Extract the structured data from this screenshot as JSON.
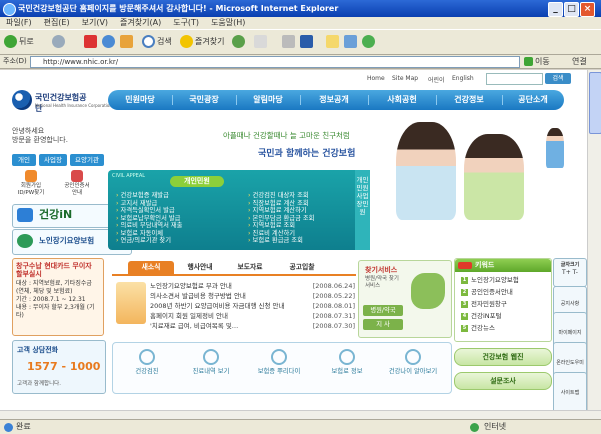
{
  "window": {
    "title": "국민건강보험공단 홈페이지를 방문해주셔서 감사합니다! - Microsoft Internet Explorer",
    "buttons": [
      "_",
      "□",
      "×"
    ]
  },
  "menubar": [
    "파일(F)",
    "편집(E)",
    "보기(V)",
    "즐겨찾기(A)",
    "도구(T)",
    "도움말(H)"
  ],
  "toolbar": {
    "back": "뒤로",
    "search": "검색",
    "favorites": "즐겨찾기"
  },
  "address": {
    "label": "주소(D)",
    "url": "http://www.nhic.or.kr/",
    "go": "이동",
    "links": "연결"
  },
  "top_links": [
    "Home",
    "Site Map",
    "어린이",
    "English"
  ],
  "search_button": "검색",
  "logo": {
    "name": "국민건강보험공단",
    "sub": "National Health Insurance Corporation"
  },
  "gnb": [
    "민원마당",
    "국민광장",
    "알림마당",
    "정보공개",
    "사회공헌",
    "건강정보",
    "공단소개"
  ],
  "greeting": [
    "안녕하세요",
    "방문을 환영합니다."
  ],
  "quick_buttons": [
    "개인",
    "사업장",
    "요양기관"
  ],
  "left_icons": [
    "회원가입 ID/PW찾기",
    "공인인증서 안내"
  ],
  "banners": [
    "건강iN",
    "노인장기요양보험"
  ],
  "promo": {
    "title": "창구수납 현대카드 무이자 할부실시",
    "lines": [
      "대상 : 지역보험료, 기타징수금",
      "(연체, 체당 및 보험료)",
      "기간 : 2008.7.1 ~ 12.31",
      "내용 : 무이자 할부 2,3개월 (기타)"
    ]
  },
  "consult": {
    "title": "고객 상담전화",
    "number": "1577 - 1000",
    "sub": "고객과 함께합니다."
  },
  "hero": {
    "subtitle": "아플때나 건강할때나 늘 고마운 친구처럼",
    "title": "국민과 함께하는 건강보험"
  },
  "civil": {
    "tag": "CIVIL APPEAL",
    "tab": "개인민원",
    "left": [
      "건강보험증 재발급",
      "고지서 재발급",
      "자격득실확인서 발급",
      "보험료납부확인서 발급",
      "의료비 부담내역서 재출",
      "보험료 자동이체",
      "연금/의료기관 찾기"
    ],
    "right": [
      "건강검진 대상자 조회",
      "직장보험료 계산 조회",
      "지역보험료 계산하기",
      "본인부담금 환급금 조회",
      "지역보험료 조회",
      "진료비 계산하기",
      "보험료 환급금 조회"
    ],
    "vtab": "개인민원 사업장민원"
  },
  "news": {
    "tabs": [
      "새소식",
      "행사안내",
      "보도자료",
      "공고입찰"
    ],
    "items": [
      {
        "title": "노인장기요양보험료 부과 안내",
        "date": "[2008.06.24]"
      },
      {
        "title": "의사소견서 발급비용 청구방법 안내",
        "date": "[2008.05.22]"
      },
      {
        "title": "2008년 하반기 요양급여비용 자금대행 신청 안내",
        "date": "[2008.08.01]"
      },
      {
        "title": "홈페이지 회원 일제정비 안내",
        "date": "[2008.07.31]"
      },
      {
        "title": "'치료재료 급여, 비급여목록 및…",
        "date": "[2008.07.30]"
      }
    ]
  },
  "find_service": {
    "title": "찾기서비스",
    "sub": "병원/약국 찾기 서비스",
    "buttons": [
      "병원/약국",
      "지 사"
    ]
  },
  "keywords": {
    "title": "키워드",
    "items": [
      "노인장기요양보험",
      "공인인증서안내",
      "전자민원창구",
      "건강iN포털",
      "건강뉴스"
    ]
  },
  "quick_services": [
    "건강검진",
    "진료내역 보기",
    "보험증 뿌리다이",
    "보험료 정보",
    "건강나이 알아보기"
  ],
  "green_buttons": [
    "건강보험 웹진",
    "설문조사"
  ],
  "right_side": [
    "글자크기",
    "T+ T-",
    "공지사항",
    "마이페이지",
    "온라인도우미",
    "사이트맵"
  ],
  "status": {
    "text": "완료",
    "zone": "인터넷"
  }
}
